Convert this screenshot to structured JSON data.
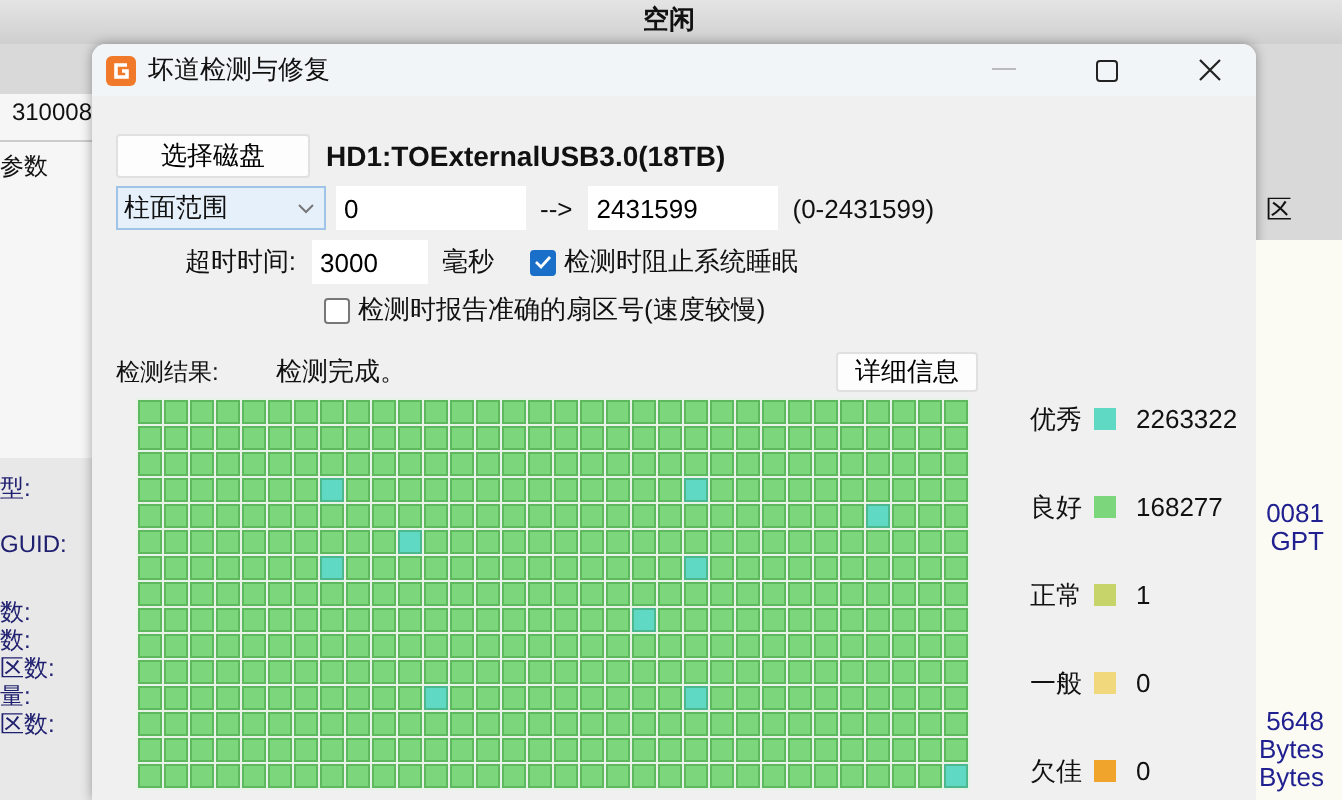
{
  "background_app": {
    "header": "空闲",
    "left_texts": [
      "310008",
      "参数",
      "型:",
      "GUID:",
      "数:",
      "数:",
      "区数:",
      "量:",
      "区数:"
    ],
    "right_texts": [
      "区",
      "0081",
      "GPT",
      "5648",
      "Bytes",
      "Bytes"
    ]
  },
  "window": {
    "title": "坏道检测与修复"
  },
  "select_disk_button": "选择磁盘",
  "disk_name": "HD1:TOExternalUSB3.0(18TB)",
  "range": {
    "mode": "柱面范围",
    "start": "0",
    "arrow": "-->",
    "end": "2431599",
    "limits": "(0-2431599)"
  },
  "timeout": {
    "label": "超时时间:",
    "value": "3000",
    "unit": "毫秒"
  },
  "options": [
    {
      "label": "检测时阻止系统睡眠",
      "checked": true
    },
    {
      "label": "检测时报告准确的扇区号(速度较慢)",
      "checked": false
    }
  ],
  "result": {
    "label": "检测结果:",
    "status": "检测完成。",
    "details_button": "详细信息"
  },
  "legend": [
    {
      "label": "优秀",
      "color": "#5fd8c4",
      "count": "2263322"
    },
    {
      "label": "良好",
      "color": "#7cd67c",
      "count": "168277"
    },
    {
      "label": "正常",
      "color": "#c6d46a",
      "count": "1"
    },
    {
      "label": "一般",
      "color": "#f2d87c",
      "count": "0"
    },
    {
      "label": "欠佳",
      "color": "#f0a42c",
      "count": "0"
    }
  ],
  "block_map": [
    [
      {
        "color": "#7cd67c"
      },
      {
        "color": "#7cd67c"
      },
      {
        "color": "#7cd67c"
      },
      {
        "color": "#7cd67c"
      },
      {
        "color": "#7cd67c"
      },
      {
        "color": "#7cd67c"
      },
      {
        "color": "#7cd67c"
      },
      {
        "color": "#7cd67c"
      },
      {
        "color": "#7cd67c"
      },
      {
        "color": "#7cd67c"
      },
      {
        "color": "#7cd67c"
      },
      {
        "color": "#7cd67c"
      },
      {
        "color": "#7cd67c"
      },
      {
        "color": "#7cd67c"
      },
      {
        "color": "#7cd67c"
      },
      {
        "color": "#7cd67c"
      },
      {
        "color": "#7cd67c"
      },
      {
        "color": "#7cd67c"
      },
      {
        "color": "#7cd67c"
      },
      {
        "color": "#7cd67c"
      },
      {
        "color": "#7cd67c"
      },
      {
        "color": "#7cd67c"
      },
      {
        "color": "#7cd67c"
      },
      {
        "color": "#7cd67c"
      },
      {
        "color": "#7cd67c"
      },
      {
        "color": "#7cd67c"
      },
      {
        "color": "#7cd67c"
      },
      {
        "color": "#7cd67c"
      },
      {
        "color": "#7cd67c"
      },
      {
        "color": "#7cd67c"
      },
      {
        "color": "#7cd67c"
      },
      {
        "color": "#7cd67c"
      }
    ],
    [
      {
        "color": "#7cd67c"
      },
      {
        "color": "#7cd67c"
      },
      {
        "color": "#7cd67c"
      },
      {
        "color": "#7cd67c"
      },
      {
        "color": "#7cd67c"
      },
      {
        "color": "#7cd67c"
      },
      {
        "color": "#7cd67c"
      },
      {
        "color": "#7cd67c"
      },
      {
        "color": "#7cd67c"
      },
      {
        "color": "#7cd67c"
      },
      {
        "color": "#7cd67c"
      },
      {
        "color": "#7cd67c"
      },
      {
        "color": "#7cd67c"
      },
      {
        "color": "#7cd67c"
      },
      {
        "color": "#7cd67c"
      },
      {
        "color": "#7cd67c"
      },
      {
        "color": "#7cd67c"
      },
      {
        "color": "#7cd67c"
      },
      {
        "color": "#7cd67c"
      },
      {
        "color": "#7cd67c"
      },
      {
        "color": "#7cd67c"
      },
      {
        "color": "#7cd67c"
      },
      {
        "color": "#7cd67c"
      },
      {
        "color": "#7cd67c"
      },
      {
        "color": "#7cd67c"
      },
      {
        "color": "#7cd67c"
      },
      {
        "color": "#7cd67c"
      },
      {
        "color": "#7cd67c"
      },
      {
        "color": "#7cd67c"
      },
      {
        "color": "#7cd67c"
      },
      {
        "color": "#7cd67c"
      },
      {
        "color": "#7cd67c"
      }
    ],
    [
      {
        "color": "#7cd67c"
      },
      {
        "color": "#7cd67c"
      },
      {
        "color": "#7cd67c"
      },
      {
        "color": "#7cd67c"
      },
      {
        "color": "#7cd67c"
      },
      {
        "color": "#7cd67c"
      },
      {
        "color": "#7cd67c"
      },
      {
        "color": "#7cd67c"
      },
      {
        "color": "#7cd67c"
      },
      {
        "color": "#7cd67c"
      },
      {
        "color": "#7cd67c"
      },
      {
        "color": "#7cd67c"
      },
      {
        "color": "#7cd67c"
      },
      {
        "color": "#7cd67c"
      },
      {
        "color": "#7cd67c"
      },
      {
        "color": "#7cd67c"
      },
      {
        "color": "#7cd67c"
      },
      {
        "color": "#7cd67c"
      },
      {
        "color": "#7cd67c"
      },
      {
        "color": "#7cd67c"
      },
      {
        "color": "#7cd67c"
      },
      {
        "color": "#7cd67c"
      },
      {
        "color": "#7cd67c"
      },
      {
        "color": "#7cd67c"
      },
      {
        "color": "#7cd67c"
      },
      {
        "color": "#7cd67c"
      },
      {
        "color": "#7cd67c"
      },
      {
        "color": "#7cd67c"
      },
      {
        "color": "#7cd67c"
      },
      {
        "color": "#7cd67c"
      },
      {
        "color": "#7cd67c"
      },
      {
        "color": "#7cd67c"
      }
    ],
    [
      {
        "color": "#7cd67c"
      },
      {
        "color": "#7cd67c"
      },
      {
        "color": "#7cd67c"
      },
      {
        "color": "#7cd67c"
      },
      {
        "color": "#7cd67c"
      },
      {
        "color": "#7cd67c"
      },
      {
        "color": "#7cd67c"
      },
      {
        "color": "#5fd8c4"
      },
      {
        "color": "#7cd67c"
      },
      {
        "color": "#7cd67c"
      },
      {
        "color": "#7cd67c"
      },
      {
        "color": "#7cd67c"
      },
      {
        "color": "#7cd67c"
      },
      {
        "color": "#7cd67c"
      },
      {
        "color": "#7cd67c"
      },
      {
        "color": "#7cd67c"
      },
      {
        "color": "#7cd67c"
      },
      {
        "color": "#7cd67c"
      },
      {
        "color": "#7cd67c"
      },
      {
        "color": "#7cd67c"
      },
      {
        "color": "#7cd67c"
      },
      {
        "color": "#5fd8c4"
      },
      {
        "color": "#7cd67c"
      },
      {
        "color": "#7cd67c"
      },
      {
        "color": "#7cd67c"
      },
      {
        "color": "#7cd67c"
      },
      {
        "color": "#7cd67c"
      },
      {
        "color": "#7cd67c"
      },
      {
        "color": "#7cd67c"
      },
      {
        "color": "#7cd67c"
      },
      {
        "color": "#7cd67c"
      },
      {
        "color": "#7cd67c"
      }
    ],
    [
      {
        "color": "#7cd67c"
      },
      {
        "color": "#7cd67c"
      },
      {
        "color": "#7cd67c"
      },
      {
        "color": "#7cd67c"
      },
      {
        "color": "#7cd67c"
      },
      {
        "color": "#7cd67c"
      },
      {
        "color": "#7cd67c"
      },
      {
        "color": "#7cd67c"
      },
      {
        "color": "#7cd67c"
      },
      {
        "color": "#7cd67c"
      },
      {
        "color": "#7cd67c"
      },
      {
        "color": "#7cd67c"
      },
      {
        "color": "#7cd67c"
      },
      {
        "color": "#7cd67c"
      },
      {
        "color": "#7cd67c"
      },
      {
        "color": "#7cd67c"
      },
      {
        "color": "#7cd67c"
      },
      {
        "color": "#7cd67c"
      },
      {
        "color": "#7cd67c"
      },
      {
        "color": "#7cd67c"
      },
      {
        "color": "#7cd67c"
      },
      {
        "color": "#7cd67c"
      },
      {
        "color": "#7cd67c"
      },
      {
        "color": "#7cd67c"
      },
      {
        "color": "#7cd67c"
      },
      {
        "color": "#7cd67c"
      },
      {
        "color": "#7cd67c"
      },
      {
        "color": "#7cd67c"
      },
      {
        "color": "#5fd8c4"
      },
      {
        "color": "#7cd67c"
      },
      {
        "color": "#7cd67c"
      },
      {
        "color": "#7cd67c"
      }
    ],
    [
      {
        "color": "#7cd67c"
      },
      {
        "color": "#7cd67c"
      },
      {
        "color": "#7cd67c"
      },
      {
        "color": "#7cd67c"
      },
      {
        "color": "#7cd67c"
      },
      {
        "color": "#7cd67c"
      },
      {
        "color": "#7cd67c"
      },
      {
        "color": "#7cd67c"
      },
      {
        "color": "#7cd67c"
      },
      {
        "color": "#7cd67c"
      },
      {
        "color": "#5fd8c4"
      },
      {
        "color": "#7cd67c"
      },
      {
        "color": "#7cd67c"
      },
      {
        "color": "#7cd67c"
      },
      {
        "color": "#7cd67c"
      },
      {
        "color": "#7cd67c"
      },
      {
        "color": "#7cd67c"
      },
      {
        "color": "#7cd67c"
      },
      {
        "color": "#7cd67c"
      },
      {
        "color": "#7cd67c"
      },
      {
        "color": "#7cd67c"
      },
      {
        "color": "#7cd67c"
      },
      {
        "color": "#7cd67c"
      },
      {
        "color": "#7cd67c"
      },
      {
        "color": "#7cd67c"
      },
      {
        "color": "#7cd67c"
      },
      {
        "color": "#7cd67c"
      },
      {
        "color": "#7cd67c"
      },
      {
        "color": "#7cd67c"
      },
      {
        "color": "#7cd67c"
      },
      {
        "color": "#7cd67c"
      },
      {
        "color": "#7cd67c"
      }
    ],
    [
      {
        "color": "#7cd67c"
      },
      {
        "color": "#7cd67c"
      },
      {
        "color": "#7cd67c"
      },
      {
        "color": "#7cd67c"
      },
      {
        "color": "#7cd67c"
      },
      {
        "color": "#7cd67c"
      },
      {
        "color": "#7cd67c"
      },
      {
        "color": "#5fd8c4"
      },
      {
        "color": "#7cd67c"
      },
      {
        "color": "#7cd67c"
      },
      {
        "color": "#7cd67c"
      },
      {
        "color": "#7cd67c"
      },
      {
        "color": "#7cd67c"
      },
      {
        "color": "#7cd67c"
      },
      {
        "color": "#7cd67c"
      },
      {
        "color": "#7cd67c"
      },
      {
        "color": "#7cd67c"
      },
      {
        "color": "#7cd67c"
      },
      {
        "color": "#7cd67c"
      },
      {
        "color": "#7cd67c"
      },
      {
        "color": "#7cd67c"
      },
      {
        "color": "#5fd8c4"
      },
      {
        "color": "#7cd67c"
      },
      {
        "color": "#7cd67c"
      },
      {
        "color": "#7cd67c"
      },
      {
        "color": "#7cd67c"
      },
      {
        "color": "#7cd67c"
      },
      {
        "color": "#7cd67c"
      },
      {
        "color": "#7cd67c"
      },
      {
        "color": "#7cd67c"
      },
      {
        "color": "#7cd67c"
      },
      {
        "color": "#7cd67c"
      }
    ],
    [
      {
        "color": "#7cd67c"
      },
      {
        "color": "#7cd67c"
      },
      {
        "color": "#7cd67c"
      },
      {
        "color": "#7cd67c"
      },
      {
        "color": "#7cd67c"
      },
      {
        "color": "#7cd67c"
      },
      {
        "color": "#7cd67c"
      },
      {
        "color": "#7cd67c"
      },
      {
        "color": "#7cd67c"
      },
      {
        "color": "#7cd67c"
      },
      {
        "color": "#7cd67c"
      },
      {
        "color": "#7cd67c"
      },
      {
        "color": "#7cd67c"
      },
      {
        "color": "#7cd67c"
      },
      {
        "color": "#7cd67c"
      },
      {
        "color": "#7cd67c"
      },
      {
        "color": "#7cd67c"
      },
      {
        "color": "#7cd67c"
      },
      {
        "color": "#7cd67c"
      },
      {
        "color": "#7cd67c"
      },
      {
        "color": "#7cd67c"
      },
      {
        "color": "#7cd67c"
      },
      {
        "color": "#7cd67c"
      },
      {
        "color": "#7cd67c"
      },
      {
        "color": "#7cd67c"
      },
      {
        "color": "#7cd67c"
      },
      {
        "color": "#7cd67c"
      },
      {
        "color": "#7cd67c"
      },
      {
        "color": "#7cd67c"
      },
      {
        "color": "#7cd67c"
      },
      {
        "color": "#7cd67c"
      },
      {
        "color": "#7cd67c"
      }
    ],
    [
      {
        "color": "#7cd67c"
      },
      {
        "color": "#7cd67c"
      },
      {
        "color": "#7cd67c"
      },
      {
        "color": "#7cd67c"
      },
      {
        "color": "#7cd67c"
      },
      {
        "color": "#7cd67c"
      },
      {
        "color": "#7cd67c"
      },
      {
        "color": "#7cd67c"
      },
      {
        "color": "#7cd67c"
      },
      {
        "color": "#7cd67c"
      },
      {
        "color": "#7cd67c"
      },
      {
        "color": "#7cd67c"
      },
      {
        "color": "#7cd67c"
      },
      {
        "color": "#7cd67c"
      },
      {
        "color": "#7cd67c"
      },
      {
        "color": "#7cd67c"
      },
      {
        "color": "#7cd67c"
      },
      {
        "color": "#7cd67c"
      },
      {
        "color": "#7cd67c"
      },
      {
        "color": "#5fd8c4"
      },
      {
        "color": "#7cd67c"
      },
      {
        "color": "#7cd67c"
      },
      {
        "color": "#7cd67c"
      },
      {
        "color": "#7cd67c"
      },
      {
        "color": "#7cd67c"
      },
      {
        "color": "#7cd67c"
      },
      {
        "color": "#7cd67c"
      },
      {
        "color": "#7cd67c"
      },
      {
        "color": "#7cd67c"
      },
      {
        "color": "#7cd67c"
      },
      {
        "color": "#7cd67c"
      },
      {
        "color": "#7cd67c"
      }
    ],
    [
      {
        "color": "#7cd67c"
      },
      {
        "color": "#7cd67c"
      },
      {
        "color": "#7cd67c"
      },
      {
        "color": "#7cd67c"
      },
      {
        "color": "#7cd67c"
      },
      {
        "color": "#7cd67c"
      },
      {
        "color": "#7cd67c"
      },
      {
        "color": "#7cd67c"
      },
      {
        "color": "#7cd67c"
      },
      {
        "color": "#7cd67c"
      },
      {
        "color": "#7cd67c"
      },
      {
        "color": "#7cd67c"
      },
      {
        "color": "#7cd67c"
      },
      {
        "color": "#7cd67c"
      },
      {
        "color": "#7cd67c"
      },
      {
        "color": "#7cd67c"
      },
      {
        "color": "#7cd67c"
      },
      {
        "color": "#7cd67c"
      },
      {
        "color": "#7cd67c"
      },
      {
        "color": "#7cd67c"
      },
      {
        "color": "#7cd67c"
      },
      {
        "color": "#7cd67c"
      },
      {
        "color": "#7cd67c"
      },
      {
        "color": "#7cd67c"
      },
      {
        "color": "#7cd67c"
      },
      {
        "color": "#7cd67c"
      },
      {
        "color": "#7cd67c"
      },
      {
        "color": "#7cd67c"
      },
      {
        "color": "#7cd67c"
      },
      {
        "color": "#7cd67c"
      },
      {
        "color": "#7cd67c"
      },
      {
        "color": "#7cd67c"
      }
    ],
    [
      {
        "color": "#7cd67c"
      },
      {
        "color": "#7cd67c"
      },
      {
        "color": "#7cd67c"
      },
      {
        "color": "#7cd67c"
      },
      {
        "color": "#7cd67c"
      },
      {
        "color": "#7cd67c"
      },
      {
        "color": "#7cd67c"
      },
      {
        "color": "#7cd67c"
      },
      {
        "color": "#7cd67c"
      },
      {
        "color": "#7cd67c"
      },
      {
        "color": "#7cd67c"
      },
      {
        "color": "#7cd67c"
      },
      {
        "color": "#7cd67c"
      },
      {
        "color": "#7cd67c"
      },
      {
        "color": "#7cd67c"
      },
      {
        "color": "#7cd67c"
      },
      {
        "color": "#7cd67c"
      },
      {
        "color": "#7cd67c"
      },
      {
        "color": "#7cd67c"
      },
      {
        "color": "#7cd67c"
      },
      {
        "color": "#7cd67c"
      },
      {
        "color": "#7cd67c"
      },
      {
        "color": "#7cd67c"
      },
      {
        "color": "#7cd67c"
      },
      {
        "color": "#7cd67c"
      },
      {
        "color": "#7cd67c"
      },
      {
        "color": "#7cd67c"
      },
      {
        "color": "#7cd67c"
      },
      {
        "color": "#7cd67c"
      },
      {
        "color": "#7cd67c"
      },
      {
        "color": "#7cd67c"
      },
      {
        "color": "#7cd67c"
      }
    ],
    [
      {
        "color": "#7cd67c"
      },
      {
        "color": "#7cd67c"
      },
      {
        "color": "#7cd67c"
      },
      {
        "color": "#7cd67c"
      },
      {
        "color": "#7cd67c"
      },
      {
        "color": "#7cd67c"
      },
      {
        "color": "#7cd67c"
      },
      {
        "color": "#7cd67c"
      },
      {
        "color": "#7cd67c"
      },
      {
        "color": "#7cd67c"
      },
      {
        "color": "#7cd67c"
      },
      {
        "color": "#5fd8c4"
      },
      {
        "color": "#7cd67c"
      },
      {
        "color": "#7cd67c"
      },
      {
        "color": "#7cd67c"
      },
      {
        "color": "#7cd67c"
      },
      {
        "color": "#7cd67c"
      },
      {
        "color": "#7cd67c"
      },
      {
        "color": "#7cd67c"
      },
      {
        "color": "#7cd67c"
      },
      {
        "color": "#7cd67c"
      },
      {
        "color": "#5fd8c4"
      },
      {
        "color": "#7cd67c"
      },
      {
        "color": "#7cd67c"
      },
      {
        "color": "#7cd67c"
      },
      {
        "color": "#7cd67c"
      },
      {
        "color": "#7cd67c"
      },
      {
        "color": "#7cd67c"
      },
      {
        "color": "#7cd67c"
      },
      {
        "color": "#7cd67c"
      },
      {
        "color": "#7cd67c"
      },
      {
        "color": "#7cd67c"
      }
    ],
    [
      {
        "color": "#7cd67c"
      },
      {
        "color": "#7cd67c"
      },
      {
        "color": "#7cd67c"
      },
      {
        "color": "#7cd67c"
      },
      {
        "color": "#7cd67c"
      },
      {
        "color": "#7cd67c"
      },
      {
        "color": "#7cd67c"
      },
      {
        "color": "#7cd67c"
      },
      {
        "color": "#7cd67c"
      },
      {
        "color": "#7cd67c"
      },
      {
        "color": "#7cd67c"
      },
      {
        "color": "#7cd67c"
      },
      {
        "color": "#7cd67c"
      },
      {
        "color": "#7cd67c"
      },
      {
        "color": "#7cd67c"
      },
      {
        "color": "#7cd67c"
      },
      {
        "color": "#7cd67c"
      },
      {
        "color": "#7cd67c"
      },
      {
        "color": "#7cd67c"
      },
      {
        "color": "#7cd67c"
      },
      {
        "color": "#7cd67c"
      },
      {
        "color": "#7cd67c"
      },
      {
        "color": "#7cd67c"
      },
      {
        "color": "#7cd67c"
      },
      {
        "color": "#7cd67c"
      },
      {
        "color": "#7cd67c"
      },
      {
        "color": "#7cd67c"
      },
      {
        "color": "#7cd67c"
      },
      {
        "color": "#7cd67c"
      },
      {
        "color": "#7cd67c"
      },
      {
        "color": "#7cd67c"
      },
      {
        "color": "#7cd67c"
      }
    ],
    [
      {
        "color": "#7cd67c"
      },
      {
        "color": "#7cd67c"
      },
      {
        "color": "#7cd67c"
      },
      {
        "color": "#7cd67c"
      },
      {
        "color": "#7cd67c"
      },
      {
        "color": "#7cd67c"
      },
      {
        "color": "#7cd67c"
      },
      {
        "color": "#7cd67c"
      },
      {
        "color": "#7cd67c"
      },
      {
        "color": "#7cd67c"
      },
      {
        "color": "#7cd67c"
      },
      {
        "color": "#7cd67c"
      },
      {
        "color": "#7cd67c"
      },
      {
        "color": "#7cd67c"
      },
      {
        "color": "#7cd67c"
      },
      {
        "color": "#7cd67c"
      },
      {
        "color": "#7cd67c"
      },
      {
        "color": "#7cd67c"
      },
      {
        "color": "#7cd67c"
      },
      {
        "color": "#7cd67c"
      },
      {
        "color": "#7cd67c"
      },
      {
        "color": "#7cd67c"
      },
      {
        "color": "#7cd67c"
      },
      {
        "color": "#7cd67c"
      },
      {
        "color": "#7cd67c"
      },
      {
        "color": "#7cd67c"
      },
      {
        "color": "#7cd67c"
      },
      {
        "color": "#7cd67c"
      },
      {
        "color": "#7cd67c"
      },
      {
        "color": "#7cd67c"
      },
      {
        "color": "#7cd67c"
      },
      {
        "color": "#7cd67c"
      }
    ],
    [
      {
        "color": "#7cd67c"
      },
      {
        "color": "#7cd67c"
      },
      {
        "color": "#7cd67c"
      },
      {
        "color": "#7cd67c"
      },
      {
        "color": "#7cd67c"
      },
      {
        "color": "#7cd67c"
      },
      {
        "color": "#7cd67c"
      },
      {
        "color": "#7cd67c"
      },
      {
        "color": "#7cd67c"
      },
      {
        "color": "#7cd67c"
      },
      {
        "color": "#7cd67c"
      },
      {
        "color": "#7cd67c"
      },
      {
        "color": "#7cd67c"
      },
      {
        "color": "#7cd67c"
      },
      {
        "color": "#7cd67c"
      },
      {
        "color": "#7cd67c"
      },
      {
        "color": "#7cd67c"
      },
      {
        "color": "#7cd67c"
      },
      {
        "color": "#7cd67c"
      },
      {
        "color": "#7cd67c"
      },
      {
        "color": "#7cd67c"
      },
      {
        "color": "#7cd67c"
      },
      {
        "color": "#7cd67c"
      },
      {
        "color": "#7cd67c"
      },
      {
        "color": "#7cd67c"
      },
      {
        "color": "#7cd67c"
      },
      {
        "color": "#7cd67c"
      },
      {
        "color": "#7cd67c"
      },
      {
        "color": "#7cd67c"
      },
      {
        "color": "#7cd67c"
      },
      {
        "color": "#7cd67c"
      },
      {
        "color": "#5fd8c4"
      }
    ]
  ]
}
